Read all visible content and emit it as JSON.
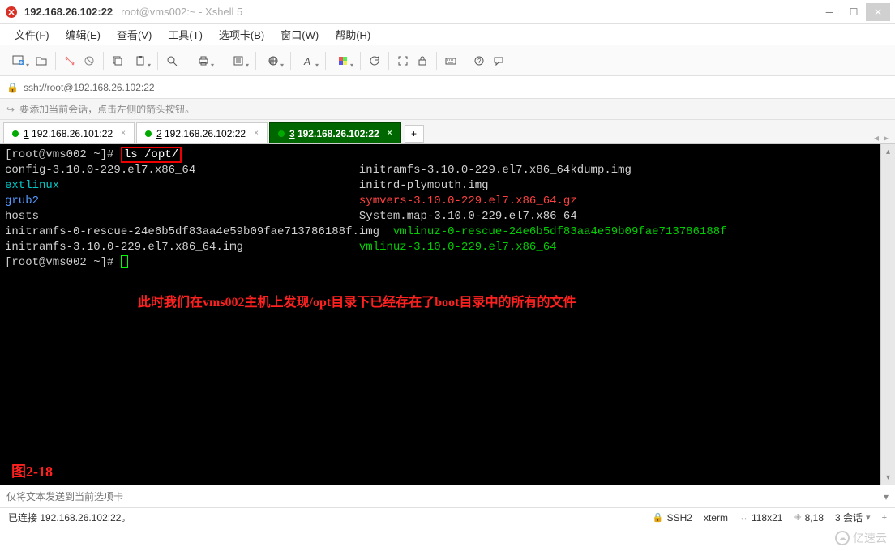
{
  "titlebar": {
    "main": "192.168.26.102:22",
    "sub": "root@vms002:~ - Xshell 5"
  },
  "menu": {
    "file": "文件(F)",
    "edit": "编辑(E)",
    "view": "查看(V)",
    "tools": "工具(T)",
    "tabs": "选项卡(B)",
    "window": "窗口(W)",
    "help": "帮助(H)"
  },
  "address": "ssh://root@192.168.26.102:22",
  "hint": "要添加当前会话，点击左侧的箭头按钮。",
  "tabs": [
    {
      "label": "1 192.168.26.101:22",
      "active": false
    },
    {
      "label": "2 192.168.26.102:22",
      "active": false
    },
    {
      "label": "3 192.168.26.102:22",
      "active": true
    }
  ],
  "terminal": {
    "prompt": "[root@vms002 ~]#",
    "command": "ls /opt/",
    "col2_offset": "                                                    ",
    "rows": [
      {
        "c1": "config-3.10.0-229.el7.x86_64",
        "c2": "initramfs-3.10.0-229.el7.x86_64kdump.img",
        "s1": "",
        "s2": ""
      },
      {
        "c1": "extlinux",
        "c2": "initrd-plymouth.img",
        "s1": "t-cyan",
        "s2": ""
      },
      {
        "c1": "grub2",
        "c2": "symvers-3.10.0-229.el7.x86_64.gz",
        "s1": "t-blue",
        "s2": "t-red"
      },
      {
        "c1": "hosts",
        "c2": "System.map-3.10.0-229.el7.x86_64",
        "s1": "",
        "s2": ""
      },
      {
        "c1": "initramfs-0-rescue-24e6b5df83aa4e59b09fae713786188f.img",
        "c2": "vmlinuz-0-rescue-24e6b5df83aa4e59b09fae713786188f",
        "s1": "",
        "s2": "t-green"
      },
      {
        "c1": "initramfs-3.10.0-229.el7.x86_64.img",
        "c2": "vmlinuz-3.10.0-229.el7.x86_64",
        "s1": "",
        "s2": "t-green"
      }
    ],
    "annotation": "此时我们在vms002主机上发现/opt目录下已经存在了boot目录中的所有的文件",
    "figure_label": "图2-18"
  },
  "bottom_input_placeholder": "仅将文本发送到当前选项卡",
  "status": {
    "left": "已连接 192.168.26.102:22。",
    "ssh": "SSH2",
    "term": "xterm",
    "size": "118x21",
    "pos": "8,18",
    "sessions": "3 会话",
    "size_icon": "↔",
    "pos_icon": "⁜",
    "lock_icon": "🔒",
    "sessions_dd": "▾",
    "add_icon": "+"
  },
  "watermark": "亿速云"
}
